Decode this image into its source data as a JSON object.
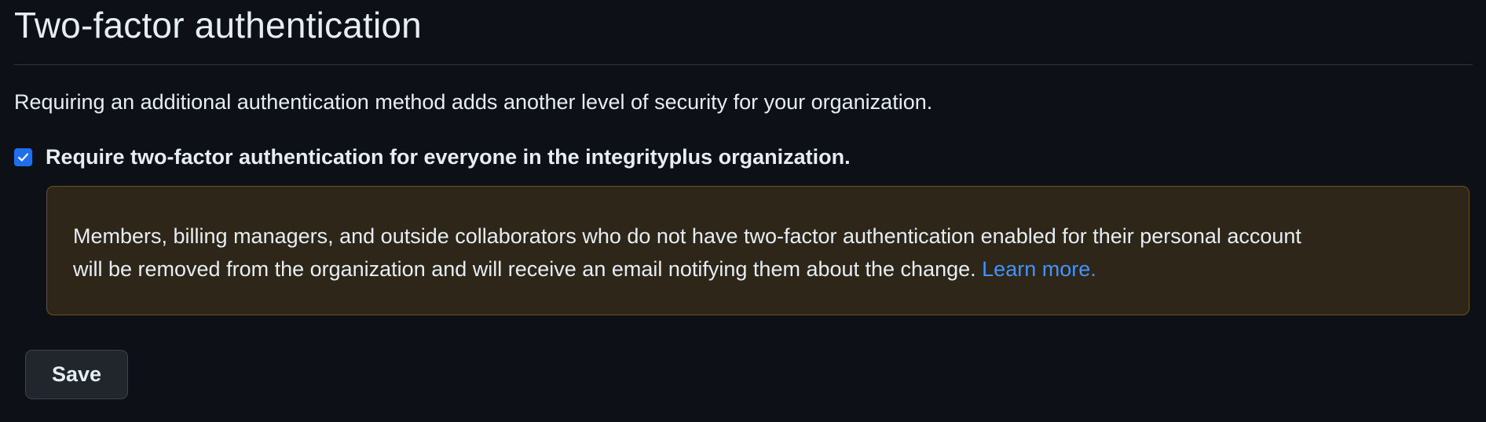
{
  "page": {
    "title": "Two-factor authentication",
    "description": "Requiring an additional authentication method adds another level of security for your organization."
  },
  "require_2fa": {
    "checked": true,
    "label": "Require two-factor authentication for everyone in the integrityplus organization."
  },
  "warning": {
    "line1": "Members, billing managers, and outside collaborators who do not have two-factor authentication enabled for their personal account",
    "line2": "will be removed from the organization and will receive an email notifying them about the change.",
    "link_label": "Learn more."
  },
  "actions": {
    "save_label": "Save"
  },
  "icons": {
    "checkbox": "check-icon"
  },
  "colors": {
    "background": "#0d1117",
    "text": "#e6edf3",
    "link": "#4493f8",
    "checkbox": "#1f6feb",
    "warning_background": "#2e2619",
    "warning_border": "#6e5218",
    "button_background": "#21262d"
  }
}
